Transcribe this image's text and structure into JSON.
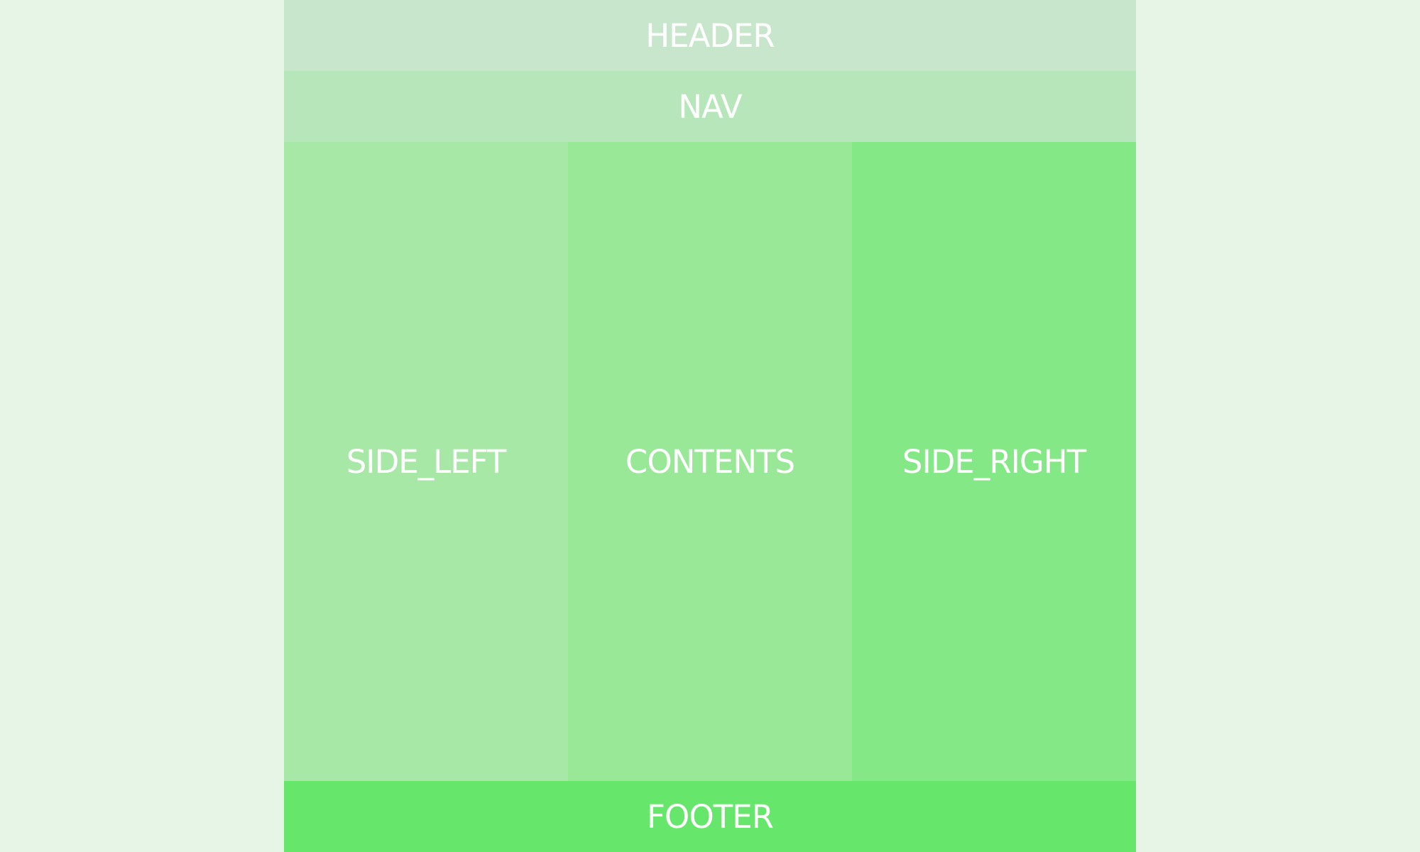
{
  "colors": {
    "background": "#e6f5e6",
    "header": "#c8e6cb",
    "nav": "#b7e6ba",
    "side_left": "#a7e8a7",
    "contents": "#98e898",
    "side_right": "#84e886",
    "footer": "#66e66a",
    "text": "#ffffff"
  },
  "layout": {
    "header": "HEADER",
    "nav": "NAV",
    "side_left": "SIDE_LEFT",
    "contents": "CONTENTS",
    "side_right": "SIDE_RIGHT",
    "footer": "FOOTER"
  }
}
